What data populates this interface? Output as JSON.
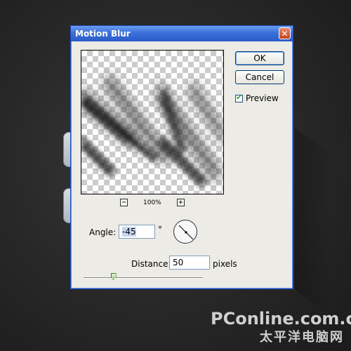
{
  "dialog": {
    "title": "Motion Blur",
    "close_glyph": "✕"
  },
  "buttons": {
    "ok_label": "OK",
    "cancel_label": "Cancel"
  },
  "preview_option": {
    "label": "Preview",
    "checked": true
  },
  "zoom": {
    "minus_glyph": "−",
    "value": "100%",
    "plus_glyph": "+"
  },
  "angle": {
    "label": "Angle:",
    "value": "-45",
    "unit": "°"
  },
  "distance": {
    "label": "Distance:",
    "value": "50",
    "unit": "pixels",
    "slider_fraction": 0.25
  },
  "watermark": {
    "logo": "PConline.com.cn",
    "subtitle": "太平洋电脑网"
  },
  "colors": {
    "titlebar": "#2a5cc9",
    "dialog_bg": "#ecebe5",
    "close": "#c8401d",
    "check": "#21a121"
  },
  "icons": {
    "close": "close-icon",
    "check": "check-icon",
    "zoom_out": "minus-icon",
    "zoom_in": "plus-icon",
    "dial": "angle-dial-icon"
  }
}
